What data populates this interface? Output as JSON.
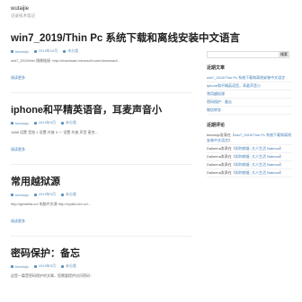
{
  "site": {
    "title": "wutaijie",
    "description": "记录技术笔记"
  },
  "posts": [
    {
      "title": "win7_2019/Thin Pc 系统下载和离线安装中文语言",
      "meta": {
        "author": "timetaijo",
        "date": "2019年10月",
        "category": "未分类"
      },
      "excerpt": "win7_2019/thin 镜像链接: http://download.microsoft.com/download/...",
      "more": "阅读更多"
    },
    {
      "title": "iphone和平精英语音，耳麦声音小",
      "meta": {
        "author": "timetaijo",
        "date": "2019年9月",
        "category": "未分类"
      },
      "excerpt": "1888 设置 音效 1 设置 外放 3 一 设置 外放 声音 麦克...",
      "more": "阅读更多"
    },
    {
      "title": "常用越狱源",
      "meta": {
        "author": "timetaijo",
        "date": "2019年9月",
        "category": "未分类"
      },
      "excerpt": "http://getdelta.co/      电脑中文源 http://cydia.ichr.cc/...",
      "more": "阅读更多"
    },
    {
      "title": "密码保护：备忘",
      "meta": {
        "author": "timetaijo",
        "date": "2019年9月",
        "category": "未分类"
      },
      "excerpt": "这是一篇受密码保护的文章，您需要提供访问密码：",
      "more": ""
    }
  ],
  "sidebar": {
    "search": {
      "placeholder": "",
      "button": "搜索"
    },
    "recent_posts": {
      "title": "近期文章",
      "items": [
        "win7_2019/Thin Pc 系统下载和离线安装中文语言",
        "iphone和平精英语音，耳麦声音小",
        "常用越狱源",
        "密码保护：备忘",
        "微信转发"
      ]
    },
    "recent_comments": {
      "title": "近期评论",
      "items": [
        {
          "author": "timetaijo",
          "mid": "发表在《",
          "link": "win7_2019/Thin Pc 系统下载和离线安装中文语言",
          "end": "》"
        },
        {
          "author": "Dalieena",
          "mid": "发表在《",
          "link": "如何修复: 大人生活 Batman",
          "end": "》"
        },
        {
          "author": "Dalieena",
          "mid": "发表在《",
          "link": "如何修复: 大人生活 Batman",
          "end": "》"
        },
        {
          "author": "Dalieena",
          "mid": "发表在《",
          "link": "如何修复: 大人生活 Batman",
          "end": "》"
        },
        {
          "author": "Dalieena",
          "mid": "发表在《",
          "link": "如何修复: 大人生活 Batman",
          "end": "》"
        }
      ]
    }
  }
}
